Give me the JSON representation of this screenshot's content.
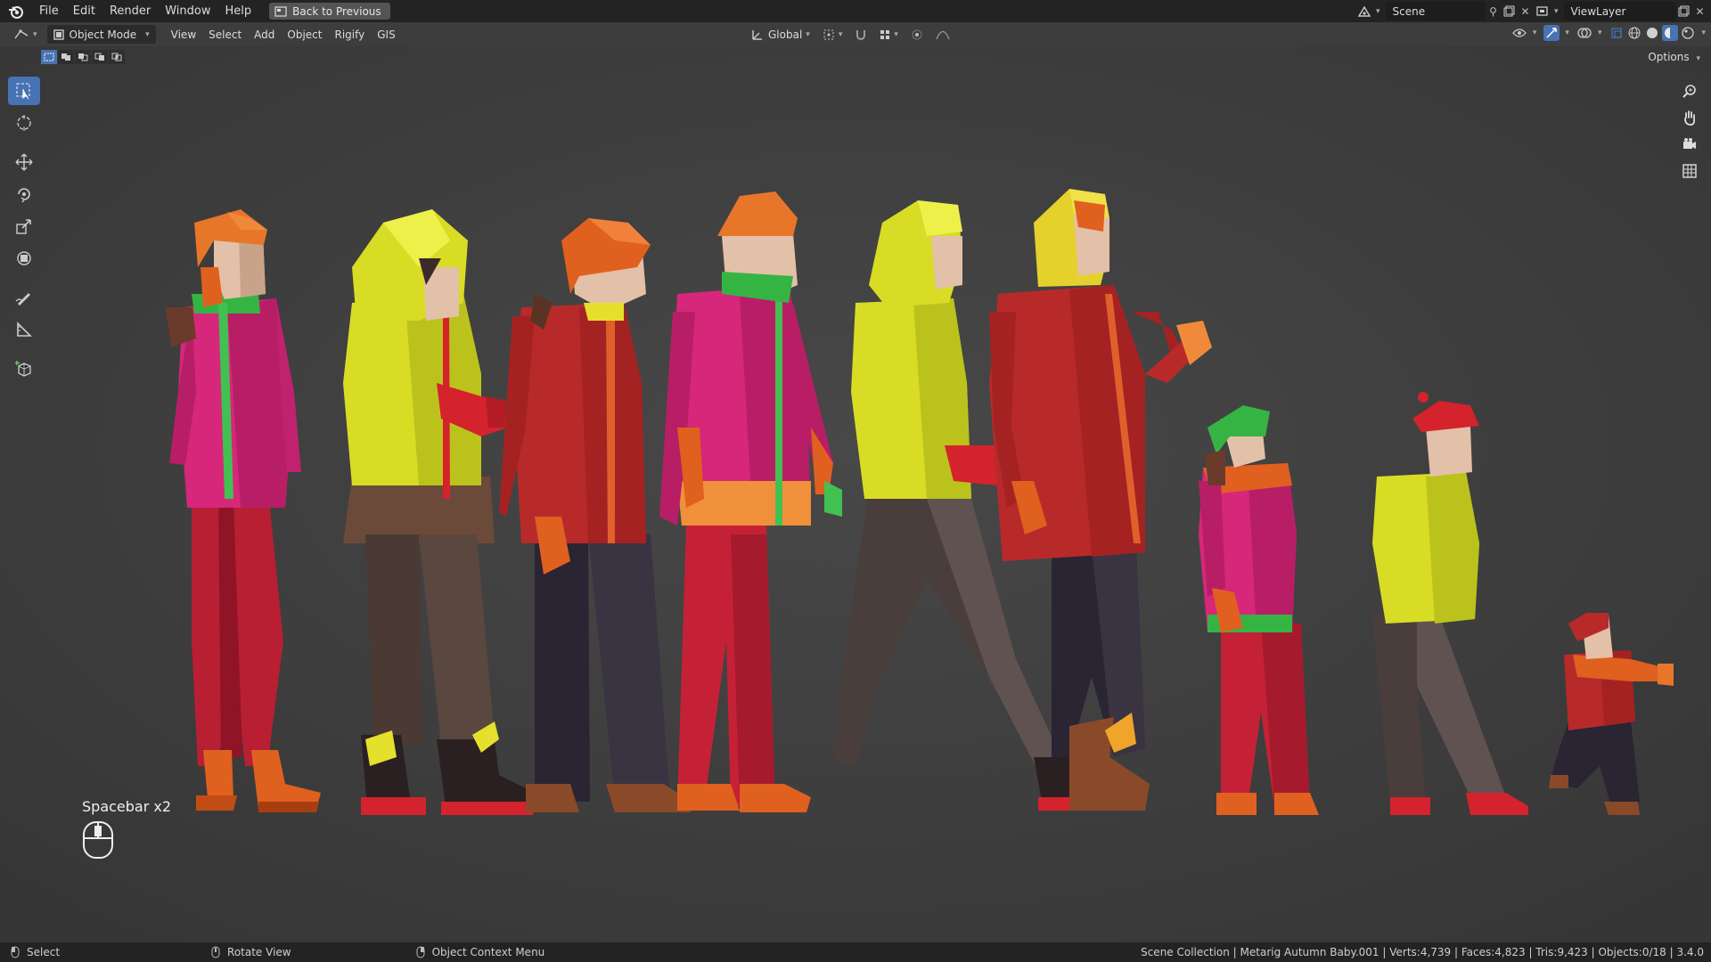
{
  "menu": {
    "items": [
      "File",
      "Edit",
      "Render",
      "Window",
      "Help"
    ],
    "back_button": "Back to Previous"
  },
  "scene_selector": {
    "value": "Scene"
  },
  "viewlayer_selector": {
    "value": "ViewLayer"
  },
  "header": {
    "mode": "Object Mode",
    "menus": [
      "View",
      "Select",
      "Add",
      "Object",
      "Rigify",
      "GIS"
    ],
    "transform_orientation": "Global",
    "options_label": "Options"
  },
  "key_overlay": {
    "text": "Spacebar x2"
  },
  "status": {
    "left": [
      {
        "icon": "mouse-left-icon",
        "label": "Select"
      },
      {
        "icon": "mouse-middle-icon",
        "label": "Rotate View"
      },
      {
        "icon": "mouse-right-icon",
        "label": "Object Context Menu"
      }
    ],
    "right": "Scene Collection | Metarig Autumn Baby.001 | Verts:4,739 | Faces:4,823 | Tris:9,423 | Objects:0/18 | 3.4.0"
  },
  "colors": {
    "accent": "#4772b3",
    "viewport_bg": "#3d3d3d",
    "topbar_bg": "#232323"
  }
}
